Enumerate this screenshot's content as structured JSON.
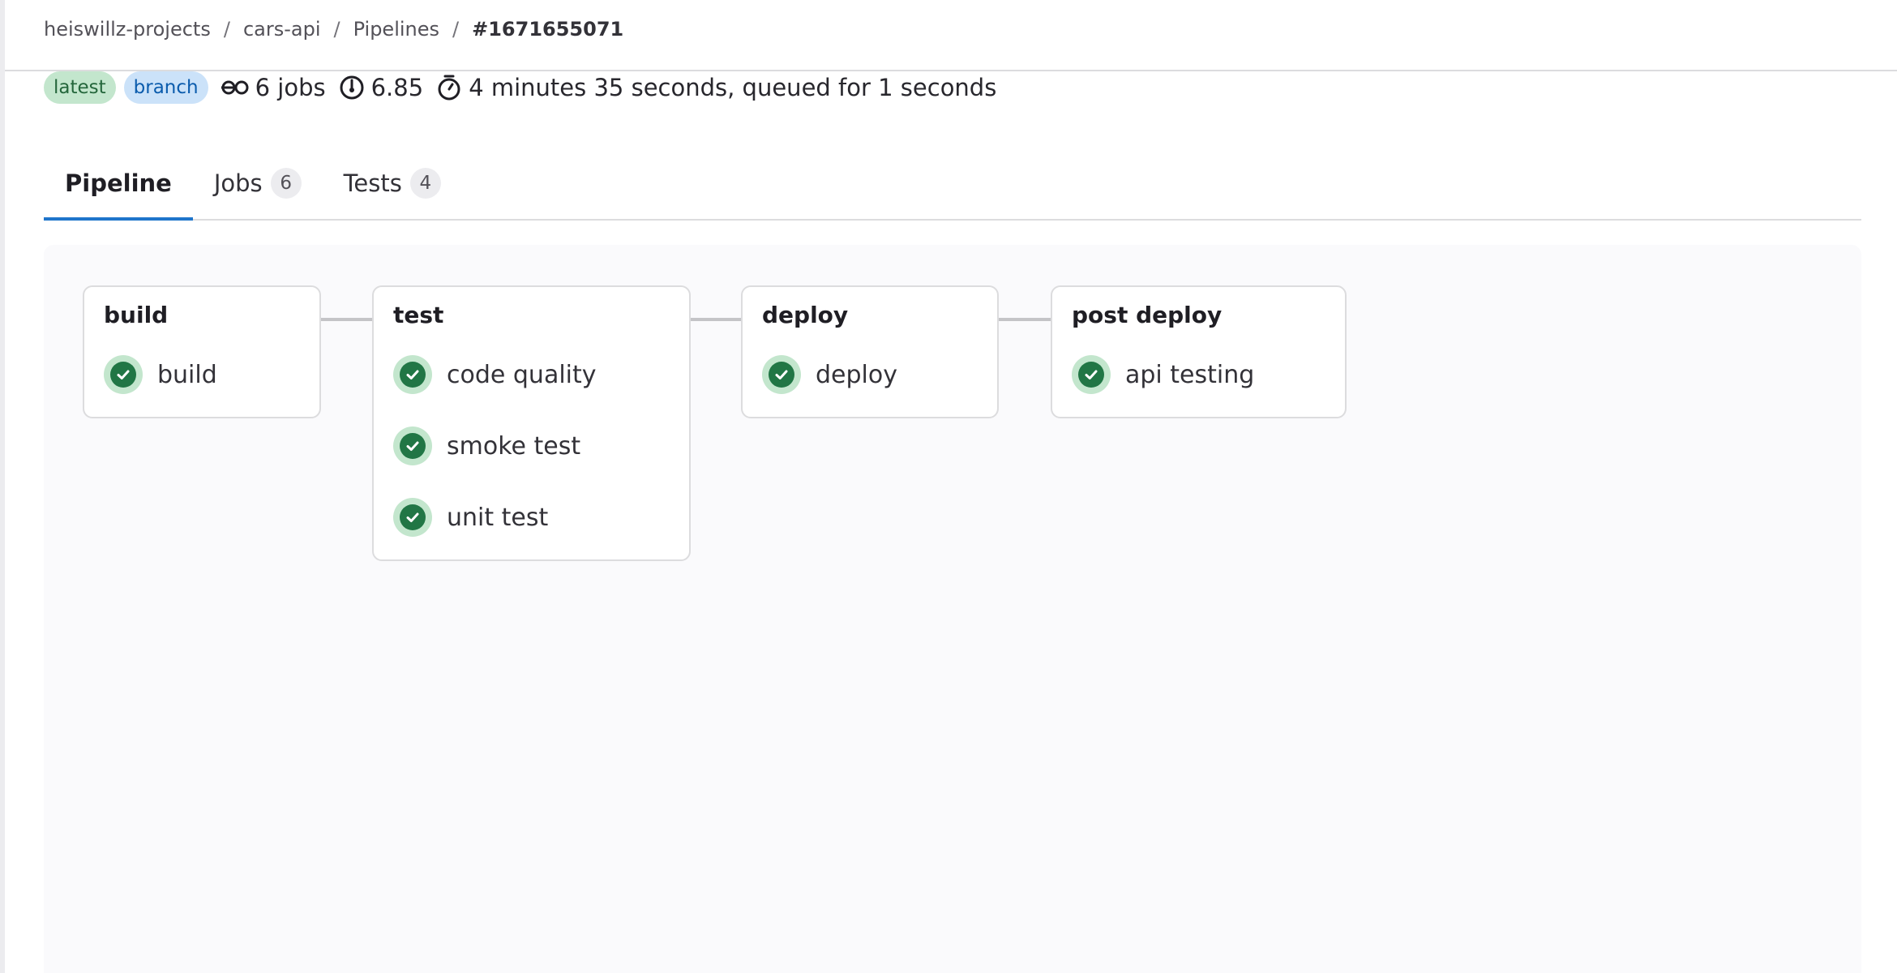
{
  "breadcrumb": {
    "items": [
      "heiswillz-projects",
      "cars-api",
      "Pipelines"
    ],
    "separator": "/",
    "current": "#1671655071"
  },
  "meta": {
    "badges": [
      {
        "label": "latest",
        "color": "#c3e6cd"
      },
      {
        "label": "branch",
        "color": "#cbe2f9"
      }
    ],
    "jobs_text": "6 jobs",
    "jobs_icon": "pipeline-icon",
    "compute_value": "6.85",
    "compute_icon": "compute-gauge-icon",
    "duration_text": "4 minutes 35 seconds, queued for 1 seconds",
    "duration_icon": "timer-icon"
  },
  "tabs": [
    {
      "label": "Pipeline",
      "active": true
    },
    {
      "label": "Jobs",
      "count": "6"
    },
    {
      "label": "Tests",
      "count": "4"
    }
  ],
  "stages": [
    {
      "name": "build",
      "jobs": [
        {
          "name": "build",
          "status": "success"
        }
      ]
    },
    {
      "name": "test",
      "jobs": [
        {
          "name": "code quality",
          "status": "success"
        },
        {
          "name": "smoke test",
          "status": "success"
        },
        {
          "name": "unit test",
          "status": "success"
        }
      ]
    },
    {
      "name": "deploy",
      "jobs": [
        {
          "name": "deploy",
          "status": "success"
        }
      ]
    },
    {
      "name": "post deploy",
      "jobs": [
        {
          "name": "api testing",
          "status": "success"
        }
      ]
    }
  ],
  "colors": {
    "success_fill": "#217645",
    "success_ring": "#c3e6cd",
    "active_tab": "#1f75cb"
  }
}
